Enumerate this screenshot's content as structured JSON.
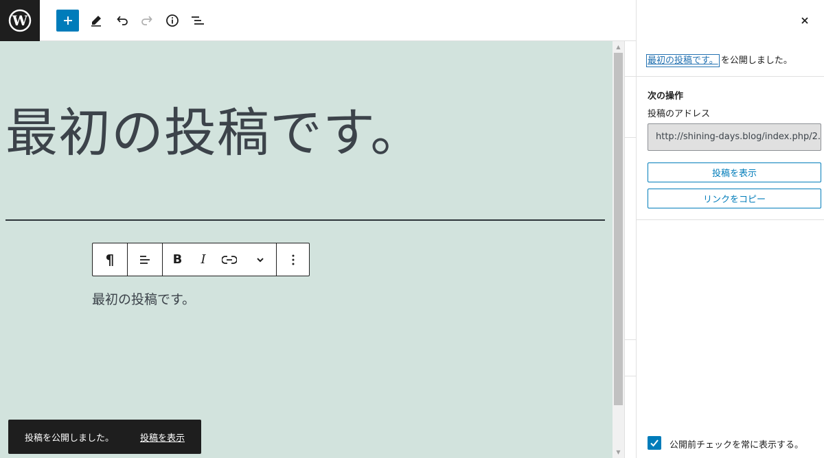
{
  "toolbar": {
    "logo": "wordpress-icon",
    "add_block": "plus-icon",
    "tools": "pencil-icon",
    "undo": "undo-icon",
    "redo": "redo-icon",
    "details": "info-icon",
    "list_view": "list-view-icon"
  },
  "editor": {
    "title": "最初の投稿です。",
    "paragraph": "最初の投稿です。",
    "block_toolbar": {
      "paragraph": "¶",
      "bold": "B",
      "italic": "I"
    }
  },
  "panel": {
    "post_link": "最初の投稿です。",
    "published_text": "を公開しました。",
    "next_steps_title": "次の操作",
    "address_label": "投稿のアドレス",
    "address_value": "http://shining-days.blog/index.php/2...",
    "view_post_button": "投稿を表示",
    "copy_link_button": "リンクをコピー",
    "checkbox_label": "公開前チェックを常に表示する。",
    "checkbox_checked": true
  },
  "snackbar": {
    "message": "投稿を公開しました。",
    "link": "投稿を表示"
  },
  "colors": {
    "accent": "#007cba",
    "canvas": "#d2e3dd",
    "dark": "#1e1e1e"
  }
}
